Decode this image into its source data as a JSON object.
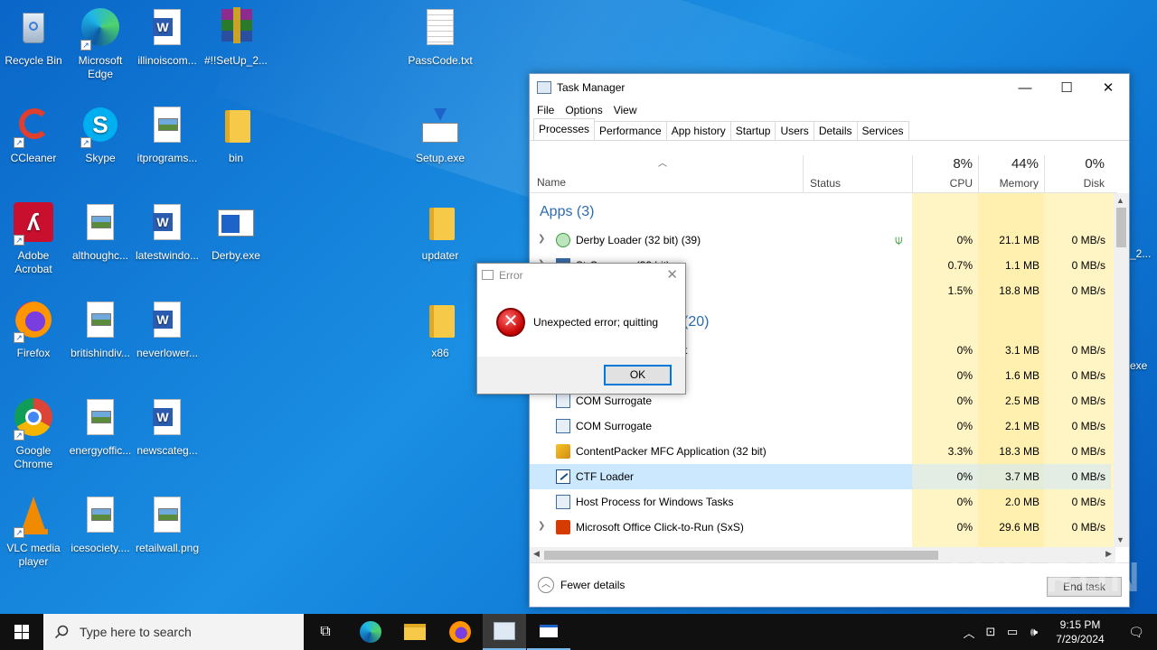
{
  "desktop": {
    "icons": [
      {
        "label": "Recycle Bin",
        "icon": "recycle-bin-icon"
      },
      {
        "label": "Microsoft Edge",
        "icon": "edge-icon"
      },
      {
        "label": "illinoiscom...",
        "icon": "word-doc-icon"
      },
      {
        "label": "#!!SetUp_2...",
        "icon": "winrar-archive-icon"
      },
      {
        "label": "PassCode.txt",
        "icon": "text-file-icon"
      },
      {
        "label": "CCleaner",
        "icon": "ccleaner-icon"
      },
      {
        "label": "Skype",
        "icon": "skype-icon"
      },
      {
        "label": "itprograms...",
        "icon": "image-file-icon"
      },
      {
        "label": "bin",
        "icon": "folder-icon"
      },
      {
        "label": "Setup.exe",
        "icon": "installer-icon"
      },
      {
        "label": "Adobe Acrobat",
        "icon": "acrobat-icon"
      },
      {
        "label": "althoughc...",
        "icon": "image-file-icon"
      },
      {
        "label": "latestwindo...",
        "icon": "word-doc-icon"
      },
      {
        "label": "Derby.exe",
        "icon": "exe-window-icon"
      },
      {
        "label": "updater",
        "icon": "folder-icon"
      },
      {
        "label": "Firefox",
        "icon": "firefox-icon"
      },
      {
        "label": "britishindiv...",
        "icon": "image-file-icon"
      },
      {
        "label": "neverlower...",
        "icon": "word-doc-icon"
      },
      {
        "label": "x86",
        "icon": "folder-icon"
      },
      {
        "label": "Google Chrome",
        "icon": "chrome-icon"
      },
      {
        "label": "energyoffic...",
        "icon": "image-file-icon"
      },
      {
        "label": "newscateg...",
        "icon": "word-doc-icon"
      },
      {
        "label": "VLC media player",
        "icon": "vlc-icon"
      },
      {
        "label": "icesociety....",
        "icon": "image-file-icon"
      },
      {
        "label": "retailwall.png",
        "icon": "image-file-icon"
      }
    ],
    "partial_right_labels": [
      "_2...",
      "exe"
    ]
  },
  "task_manager": {
    "title": "Task Manager",
    "menu": [
      "File",
      "Options",
      "View"
    ],
    "tabs": [
      "Processes",
      "Performance",
      "App history",
      "Startup",
      "Users",
      "Details",
      "Services"
    ],
    "active_tab": "Processes",
    "columns": {
      "name": "Name",
      "status": "Status",
      "cpu": {
        "pct": "8%",
        "label": "CPU"
      },
      "memory": {
        "pct": "44%",
        "label": "Memory"
      },
      "disk": {
        "pct": "0%",
        "label": "Disk"
      }
    },
    "groups": {
      "apps": "Apps (3)",
      "background_partial": "(20)"
    },
    "rows": [
      {
        "name": "Derby Loader (32 bit) (39)",
        "cpu": "0%",
        "mem": "21.1 MB",
        "disk": "0 MB/s",
        "expandable": true,
        "leaf_icon": true,
        "icon_color": "#3c9a3c"
      },
      {
        "name": "StrCmp.exe (32 bit)",
        "cpu": "0.7%",
        "mem": "1.1 MB",
        "disk": "0 MB/s",
        "expandable": true,
        "icon_color": "#3a6ea5"
      },
      {
        "name": "",
        "cpu": "1.5%",
        "mem": "18.8 MB",
        "disk": "0 MB/s"
      },
      {
        "name": "t",
        "cpu": "0%",
        "mem": "3.1 MB",
        "disk": "0 MB/s"
      },
      {
        "name": "",
        "cpu": "0%",
        "mem": "1.6 MB",
        "disk": "0 MB/s"
      },
      {
        "name": "COM Surrogate",
        "cpu": "0%",
        "mem": "2.5 MB",
        "disk": "0 MB/s",
        "icon_color": "#3a6ea5"
      },
      {
        "name": "COM Surrogate",
        "cpu": "0%",
        "mem": "2.1 MB",
        "disk": "0 MB/s",
        "icon_color": "#3a6ea5"
      },
      {
        "name": "ContentPacker MFC Application (32 bit)",
        "cpu": "3.3%",
        "mem": "18.3 MB",
        "disk": "0 MB/s",
        "icon_color": "#d4a017"
      },
      {
        "name": "CTF Loader",
        "cpu": "0%",
        "mem": "3.7 MB",
        "disk": "0 MB/s",
        "selected": true,
        "icon_color": "#1e4f8a"
      },
      {
        "name": "Host Process for Windows Tasks",
        "cpu": "0%",
        "mem": "2.0 MB",
        "disk": "0 MB/s",
        "icon_color": "#3a6ea5"
      },
      {
        "name": "Microsoft Office Click-to-Run (SxS)",
        "cpu": "0%",
        "mem": "29.6 MB",
        "disk": "0 MB/s",
        "expandable": true,
        "icon_color": "#d83b01"
      }
    ],
    "footer": {
      "fewer_details": "Fewer details",
      "end_task": "End task"
    }
  },
  "error_dialog": {
    "title": "Error",
    "message": "Unexpected error; quitting",
    "ok": "OK"
  },
  "taskbar": {
    "search_placeholder": "Type here to search",
    "time": "9:15 PM",
    "date": "7/29/2024"
  },
  "watermark": "ANY RUN"
}
